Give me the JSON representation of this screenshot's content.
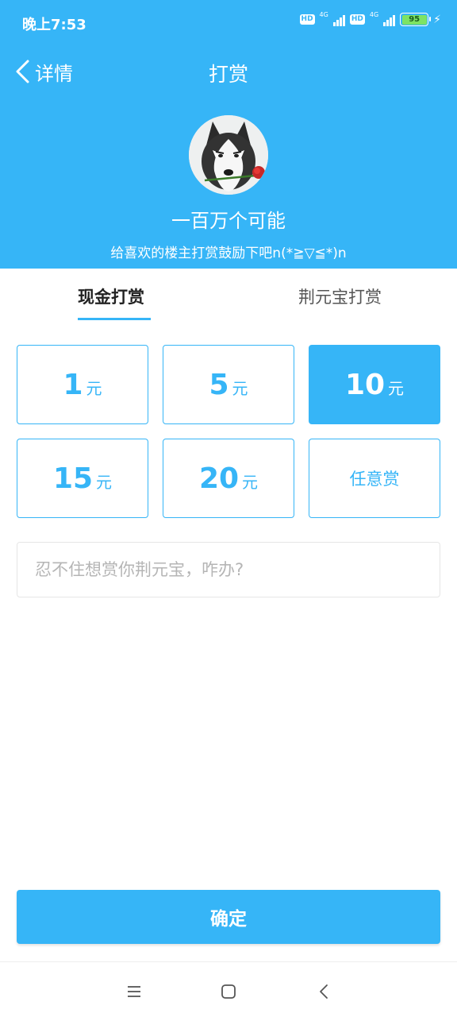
{
  "status_bar": {
    "time": "晚上7:53",
    "sim1": {
      "hd": "HD",
      "network": "4G"
    },
    "sim2": {
      "hd": "HD",
      "network": "4G"
    },
    "battery": "95",
    "battery_color": "#7de364"
  },
  "nav": {
    "back_label": "详情",
    "title": "打赏"
  },
  "profile": {
    "username": "一百万个可能",
    "subtitle": "给喜欢的楼主打赏鼓励下吧n(*≧▽≦*)n"
  },
  "tabs": [
    {
      "label": "现金打赏",
      "active": true
    },
    {
      "label": "荆元宝打赏",
      "active": false
    }
  ],
  "amounts": [
    {
      "value": "1",
      "unit": "元",
      "selected": false
    },
    {
      "value": "5",
      "unit": "元",
      "selected": false
    },
    {
      "value": "10",
      "unit": "元",
      "selected": true
    },
    {
      "value": "15",
      "unit": "元",
      "selected": false
    },
    {
      "value": "20",
      "unit": "元",
      "selected": false
    },
    {
      "label": "任意赏",
      "selected": false
    }
  ],
  "message": {
    "placeholder": "忍不住想赏你荆元宝，咋办?",
    "value": ""
  },
  "confirm_label": "确定",
  "colors": {
    "accent": "#36b5f7",
    "text_dark": "#222222",
    "placeholder": "#b5b5b5"
  },
  "system_nav": {
    "menu_icon": "menu-icon",
    "home_icon": "home-icon",
    "back_icon": "back-triangle-icon"
  }
}
